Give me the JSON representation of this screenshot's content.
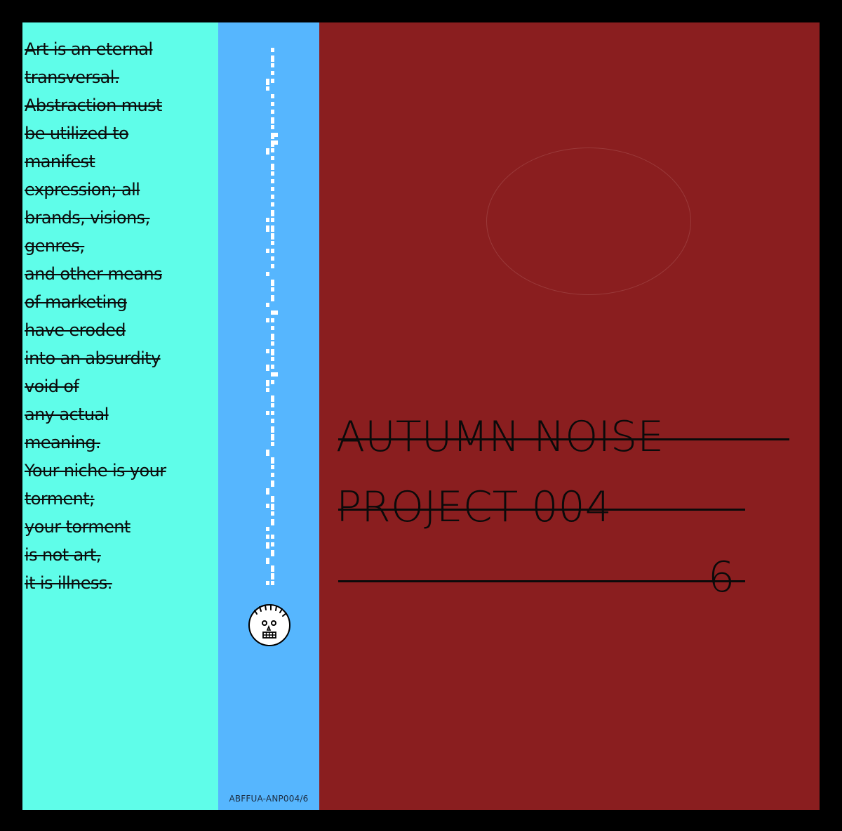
{
  "manifesto": [
    "Art is an eternal",
    "transversal.",
    "Abstraction must",
    "be utilized to",
    "manifest",
    "expression; all",
    "brands, visions,",
    "genres,",
    "and other means",
    "of marketing",
    "have eroded",
    "into an absurdity",
    "void of",
    "any actual",
    "meaning.",
    "Your niche is your",
    "torment;",
    "your torment",
    "is not art,",
    "it is illness."
  ],
  "cover": {
    "title_line_1": "AUTUMN NOISE",
    "title_line_2": "PROJECT 004",
    "title_line_3": "6"
  },
  "spine": {
    "catalog_number": "ABFFUA-ANP004/6",
    "logo_icon": "skull-face-icon"
  },
  "colors": {
    "text_panel": "#5ffde9",
    "spine": "#56b6fe",
    "cover_panel": "#8a1e1f",
    "border": "#000000"
  }
}
